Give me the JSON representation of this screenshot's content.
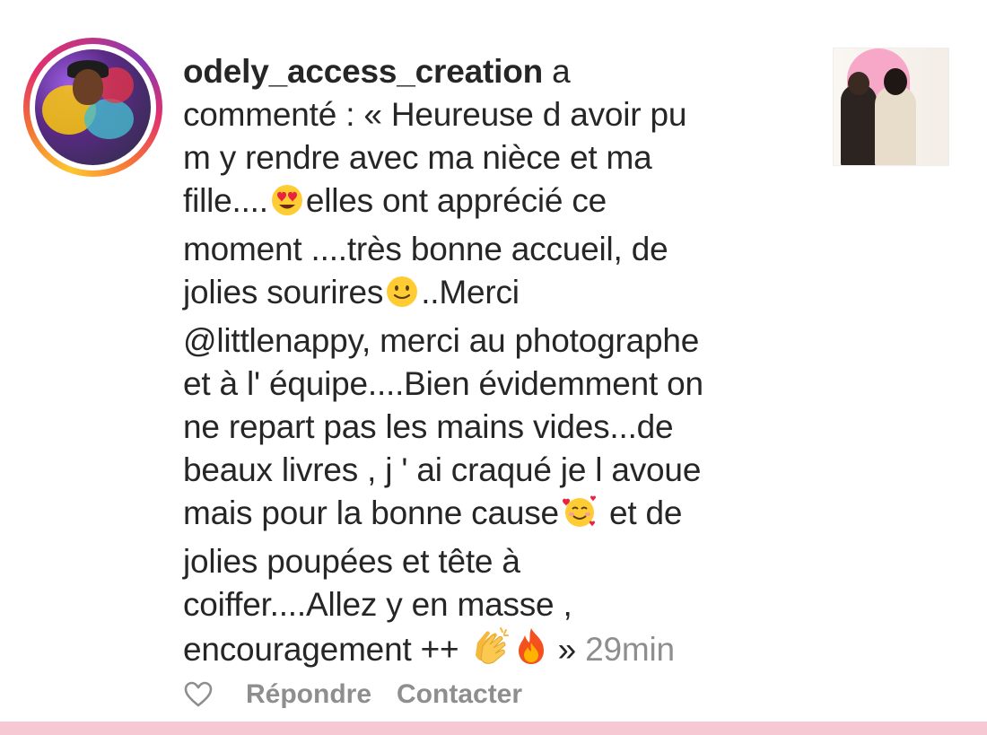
{
  "notification": {
    "username": "odely_access_creation",
    "verb_first_line": " a",
    "lines": [
      "commenté : « Heureuse d avoir pu",
      "m y rendre avec ma nièce et ma",
      "fille....",
      "elles ont apprécié ce",
      "moment ....très bonne accueil, de",
      "jolies sourires",
      "..Merci",
      "@littlenappy, merci au photographe",
      "et à l' équipe....Bien évidemment on",
      "ne repart pas les mains vides...de",
      "beaux livres , j ' ai craqué je l avoue",
      "mais pour la bonne cause",
      " et de",
      "jolies poupées et tête à",
      "coiffer....Allez y en masse ,",
      "encouragement ++ ",
      " »"
    ],
    "timestamp": "29min",
    "emojis": [
      "heart-eyes-emoji",
      "slight-smile-emoji",
      "smiling-face-with-hearts-emoji",
      "clapping-hands-emoji",
      "fire-emoji"
    ]
  },
  "actions": {
    "reply_label": "Répondre",
    "contact_label": "Contacter"
  },
  "colors": {
    "text": "#262626",
    "muted": "#8e8e8e",
    "bottom_bar": "#f6c8d3",
    "ring_start": "#fdc830",
    "ring_mid": "#e1306c",
    "ring_end": "#833ab4"
  }
}
